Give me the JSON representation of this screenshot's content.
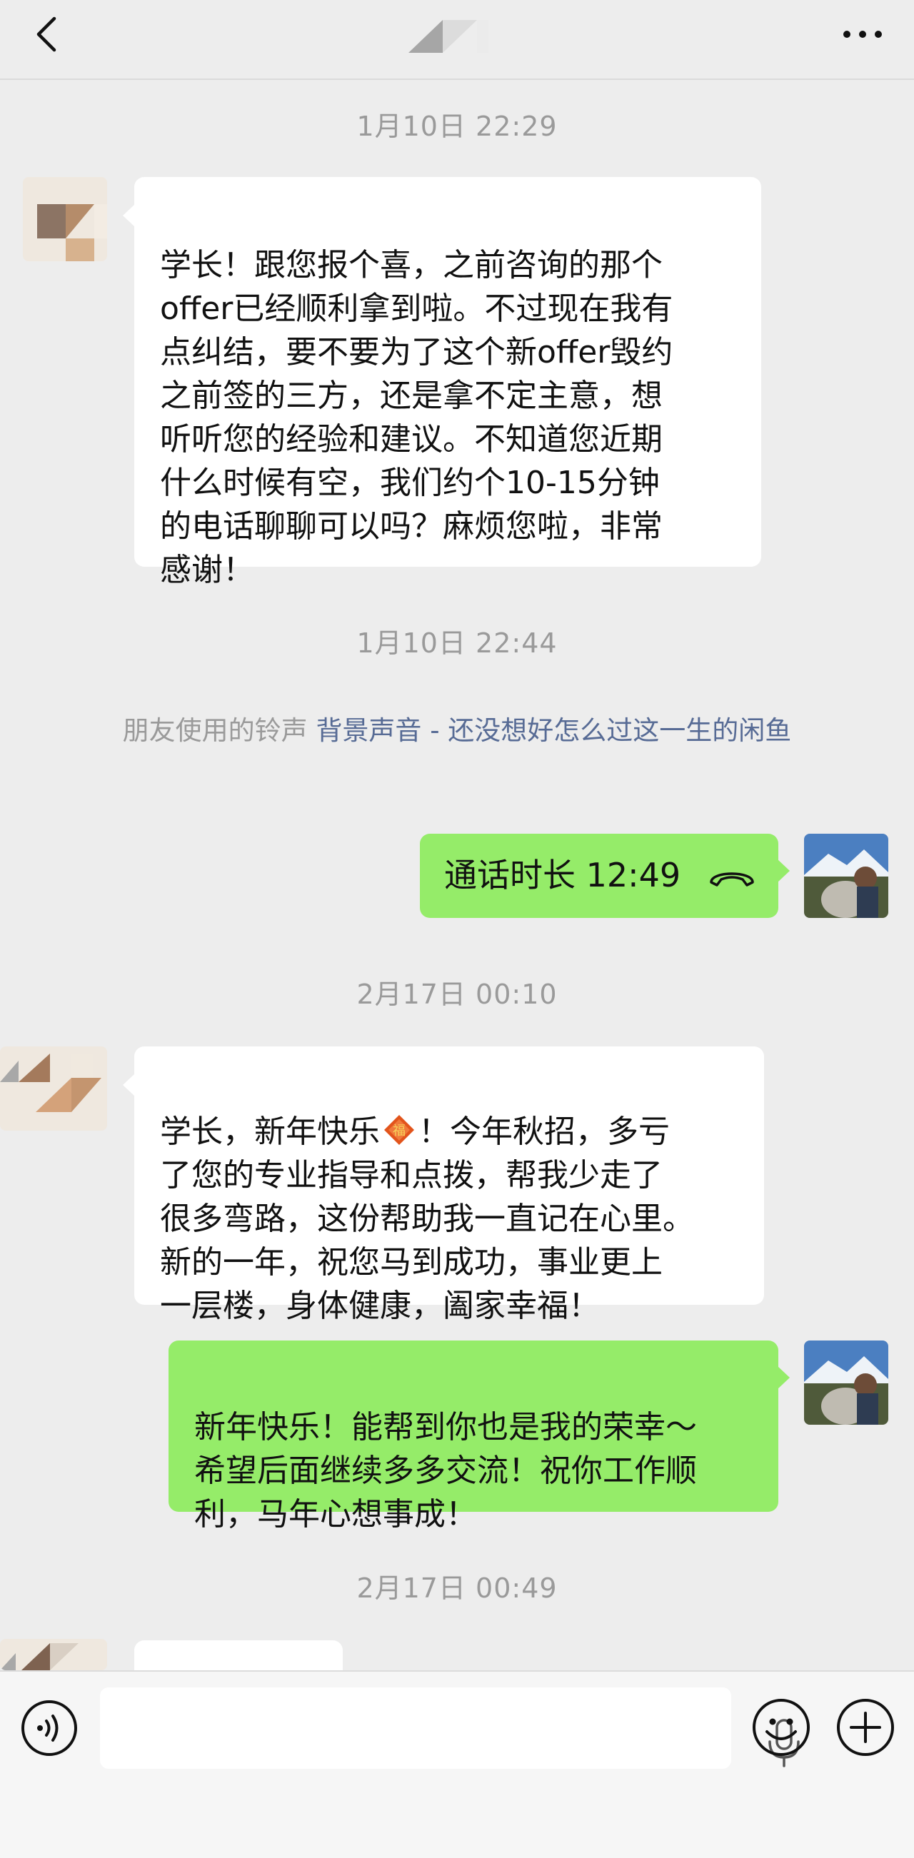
{
  "header": {
    "back_icon": "chevron-left-icon",
    "more_icon": "more-dots-icon"
  },
  "messages": {
    "ts1": "1月10日 22:29",
    "m1": "学长！跟您报个喜，之前咨询的那个\noffer已经顺利拿到啦。不过现在我有\n点纠结，要不要为了这个新offer毁约\n之前签的三方，还是拿不定主意，想\n听听您的经验和建议。不知道您近期\n什么时候有空，我们约个10-15分钟\n的电话聊聊可以吗？麻烦您啦，非常\n感谢！",
    "ts2": "1月10日 22:44",
    "ringtone_prefix": "朋友使用的铃声 ",
    "ringtone_link": "背景声音 - 还没想好怎么过这一生的闲鱼",
    "call_label": "通话时长 12:49",
    "call_icon": "phone-hangup-icon",
    "ts3": "2月17日 00:10",
    "m3_part1": "学长，新年快乐",
    "m3_emoji": "fu-icon",
    "m3_part2": "！今年秋招，多亏\n了您的专业指导和点拨，帮我少走了\n很多弯路，这份帮助我一直记在心里。\n新的一年，祝您马到成功，事业更上\n一层楼，身体健康，阖家幸福！",
    "m4": "新年快乐！能帮到你也是我的荣幸～\n希望后面继续多多交流！祝你工作顺\n利，马年心想事成！",
    "ts4": "2月17日 00:49"
  },
  "input_bar": {
    "voice_icon": "voice-icon",
    "mic_icon": "microphone-icon",
    "emoji_icon": "emoji-icon",
    "plus_icon": "plus-icon"
  },
  "colors": {
    "background": "#ededed",
    "bubble_out": "#95ec69",
    "bubble_in": "#ffffff",
    "link": "#576b95",
    "timestamp": "#9a9a9a"
  }
}
